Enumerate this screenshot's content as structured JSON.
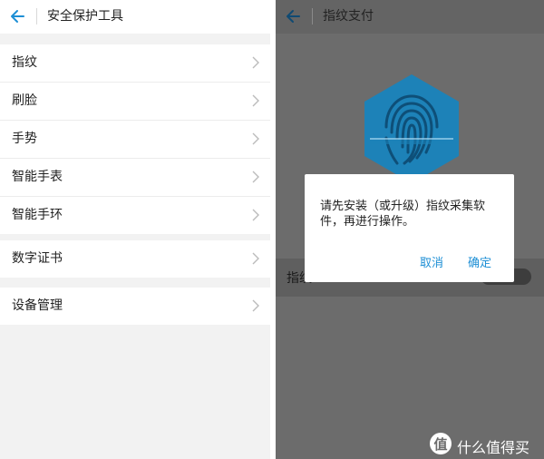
{
  "left_screen": {
    "header": {
      "title": "安全保护工具"
    },
    "groups": [
      {
        "items": [
          "指纹",
          "刷脸",
          "手势",
          "智能手表",
          "智能手环"
        ]
      },
      {
        "items": [
          "数字证书"
        ]
      },
      {
        "items": [
          "设备管理"
        ]
      }
    ]
  },
  "right_screen": {
    "header": {
      "title": "指纹支付"
    },
    "setting_label": "指纹",
    "dialog": {
      "message": "请先安装（或升级）指纹采集软件，再进行操作。",
      "cancel_label": "取消",
      "confirm_label": "确定"
    }
  },
  "watermark": {
    "logo_text": "值",
    "text": "什么值得买"
  },
  "colors": {
    "accent": "#1e8fd5",
    "fingerprint_badge": "#1d82b8",
    "overlay": "#6c6c6c"
  }
}
